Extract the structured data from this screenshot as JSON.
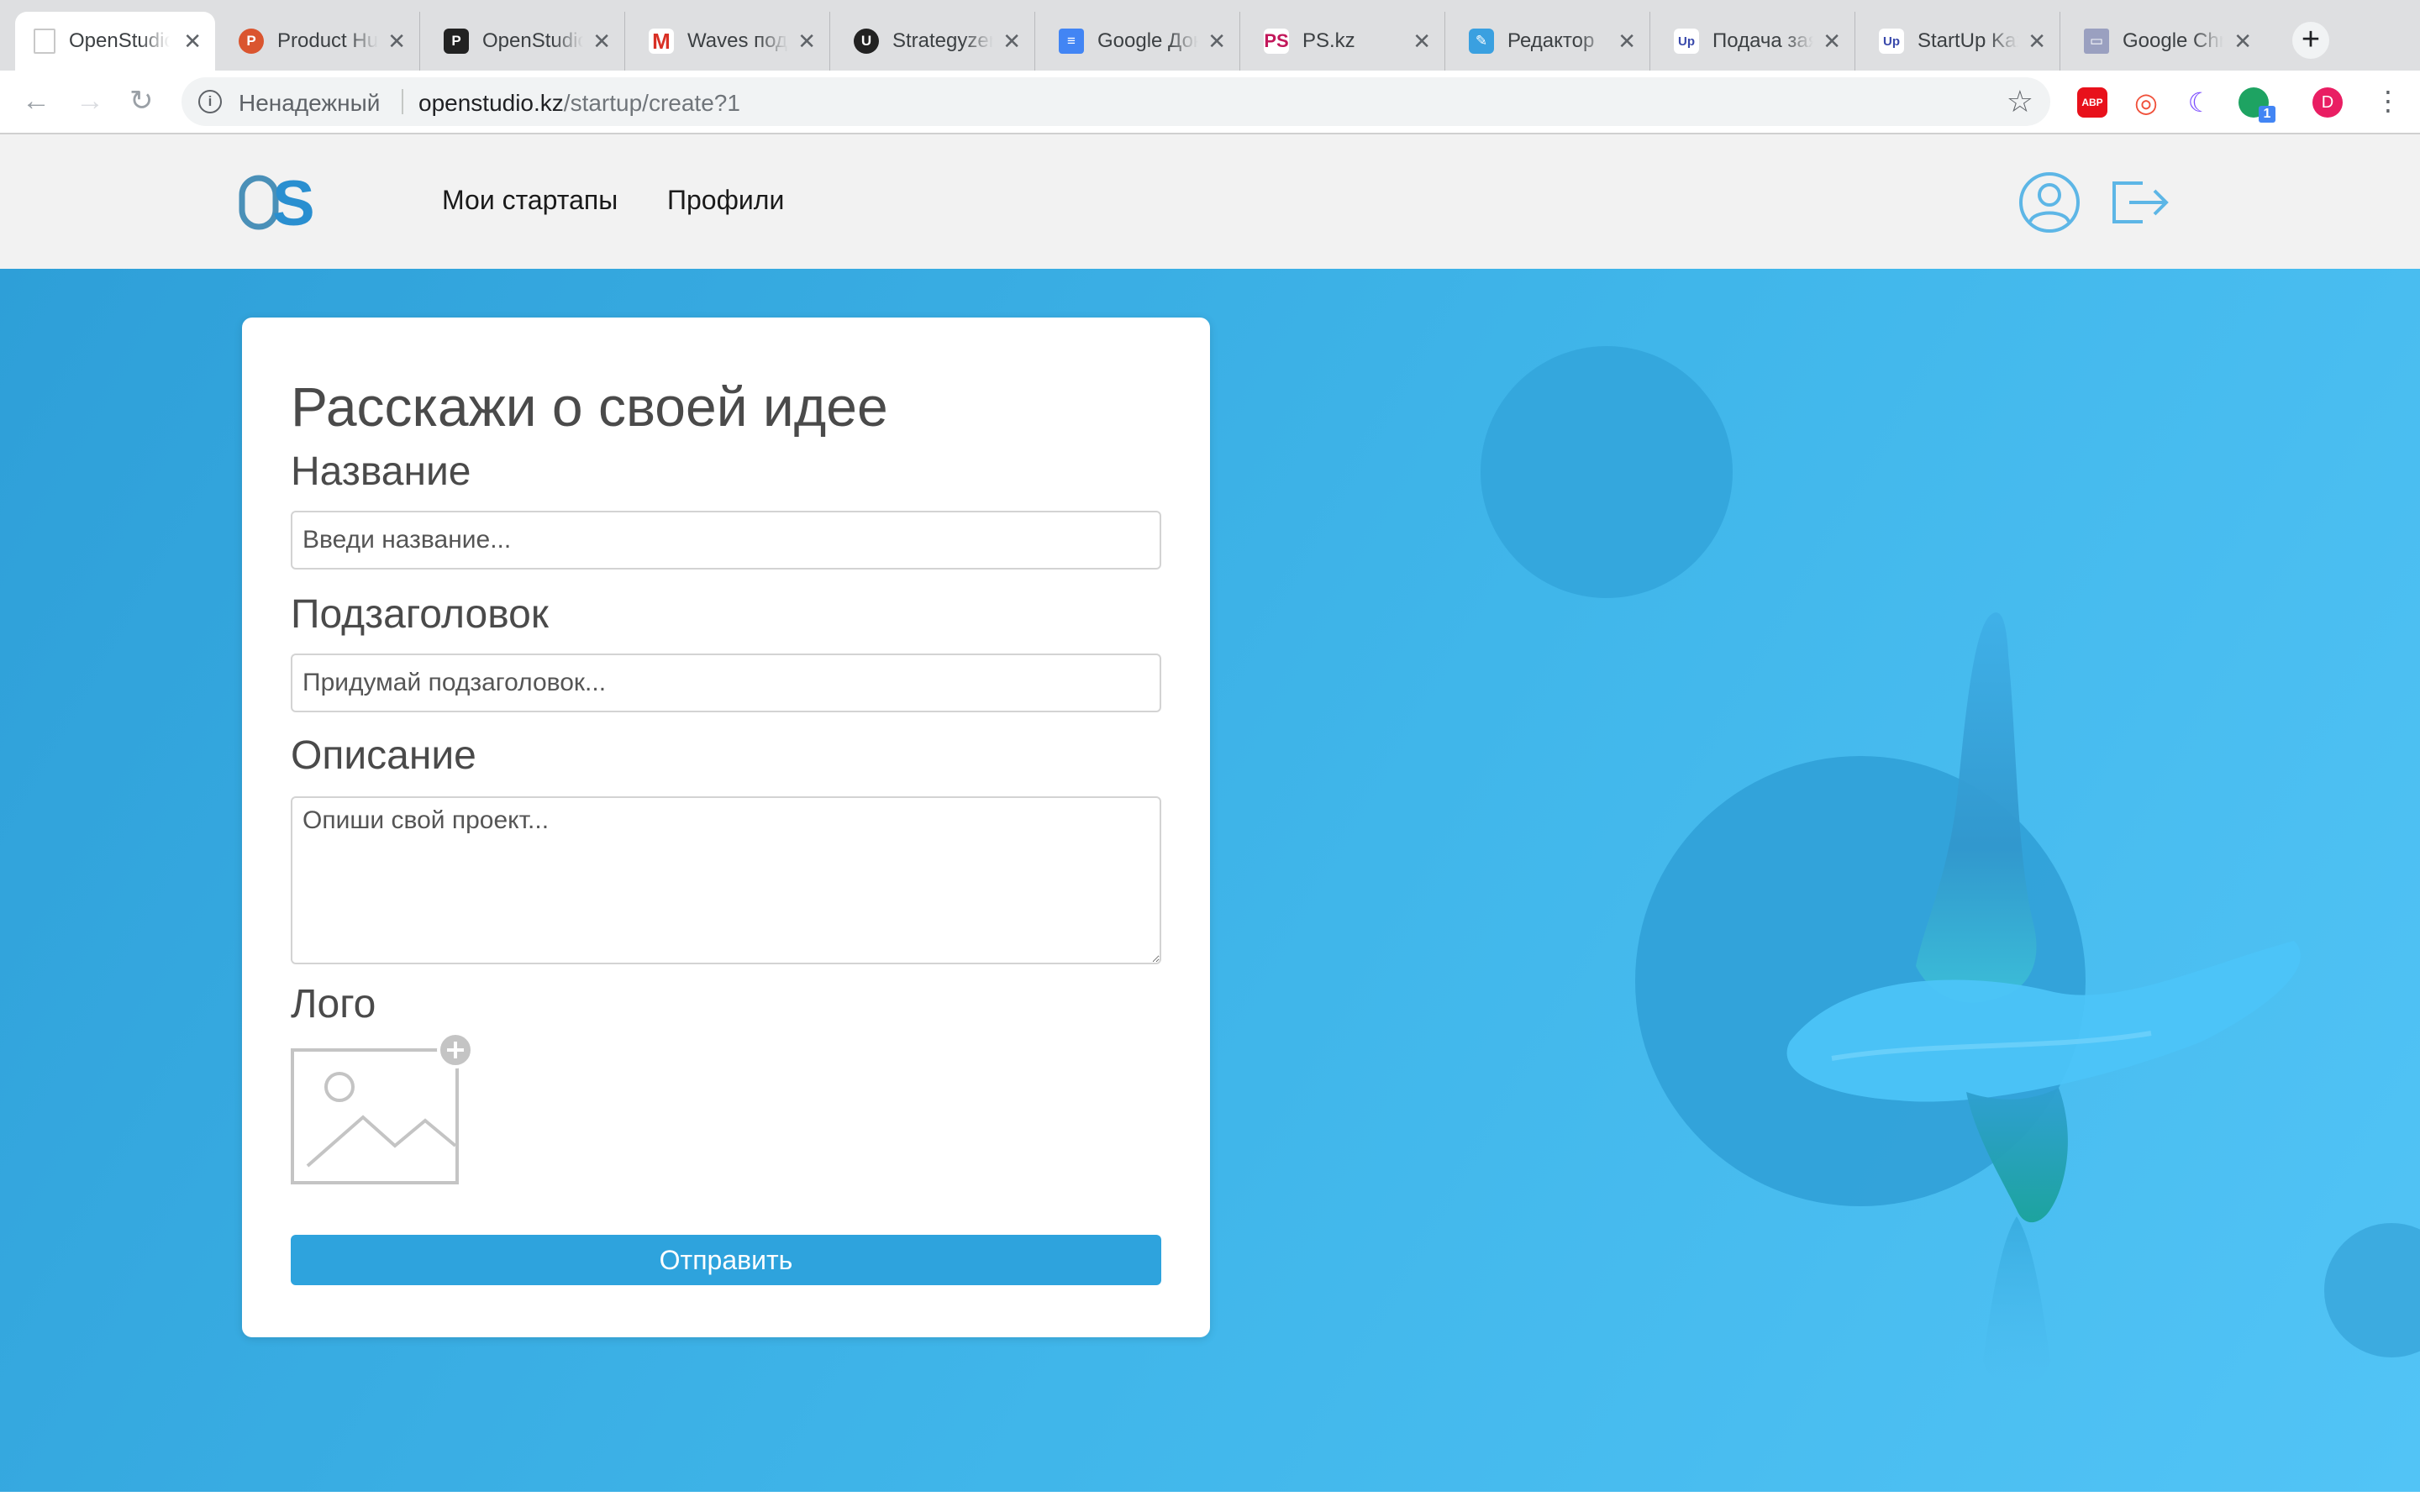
{
  "browser": {
    "tabs": [
      {
        "title": "OpenStudio",
        "favicon": "blank-page-icon",
        "color": "#ffffff"
      },
      {
        "title": "Product Hunt",
        "favicon": "product-hunt-icon",
        "color": "#da552f",
        "glyph": "P"
      },
      {
        "title": "OpenStudio",
        "favicon": "openstudio-icon",
        "color": "#222222",
        "glyph": "P"
      },
      {
        "title": "Waves подборка",
        "favicon": "gmail-icon",
        "color": "#ffffff",
        "glyph": "M"
      },
      {
        "title": "Strategyzer",
        "favicon": "strategyzer-icon",
        "color": "#222222",
        "glyph": "U"
      },
      {
        "title": "Google Документы",
        "favicon": "google-docs-icon",
        "color": "#4285f4",
        "glyph": "≡"
      },
      {
        "title": "PS.kz",
        "favicon": "ps-kz-icon",
        "color": "#ffffff",
        "glyph": "PS"
      },
      {
        "title": "Редактор",
        "favicon": "editor-icon",
        "color": "#3aa0e0",
        "glyph": "✎"
      },
      {
        "title": "Подача заявки",
        "favicon": "startup-kz-icon",
        "color": "#ffffff",
        "glyph": "Up"
      },
      {
        "title": "StartUp Kazakhstan",
        "favicon": "startup-kz-icon",
        "color": "#ffffff",
        "glyph": "Up"
      },
      {
        "title": "Google Chrome",
        "favicon": "monitor-icon",
        "color": "#9aa0c0",
        "glyph": "▭"
      }
    ],
    "close_glyph": "✕",
    "new_tab_glyph": "+",
    "back_glyph": "←",
    "forward_glyph": "→",
    "reload_glyph": "↻",
    "security_label": "Ненадежный",
    "url_host": "openstudio.kz",
    "url_path": "/startup/create?1",
    "star_glyph": "☆",
    "extensions": [
      {
        "name": "adblock-plus-icon",
        "color": "#e8111b",
        "glyph": "ABP"
      },
      {
        "name": "target-extension-icon",
        "color": "#f0503a",
        "glyph": "◎"
      },
      {
        "name": "moon-extension-icon",
        "color": "#7c4dff",
        "glyph": "☾"
      },
      {
        "name": "chat-extension-icon",
        "color": "#1ea362",
        "glyph": "●",
        "badge": "1"
      },
      {
        "name": "profile-avatar-icon",
        "color": "#e91e63",
        "glyph": "D"
      }
    ],
    "menu_glyph": "⋮"
  },
  "site": {
    "logo_text": "OS",
    "nav": [
      "Мои стартапы",
      "Профили"
    ]
  },
  "form": {
    "heading": "Расскажи о своей идее",
    "name_label": "Название",
    "name_placeholder": "Введи название...",
    "subtitle_label": "Подзаголовок",
    "subtitle_placeholder": "Придумай подзаголовок...",
    "description_label": "Описание",
    "description_placeholder": "Опиши свой проект...",
    "logo_label": "Лого",
    "submit_label": "Отправить"
  },
  "colors": {
    "brand_blue": "#2ea3dd",
    "hero_light": "#52c4f6",
    "hero_dark": "#2e9fd8"
  }
}
